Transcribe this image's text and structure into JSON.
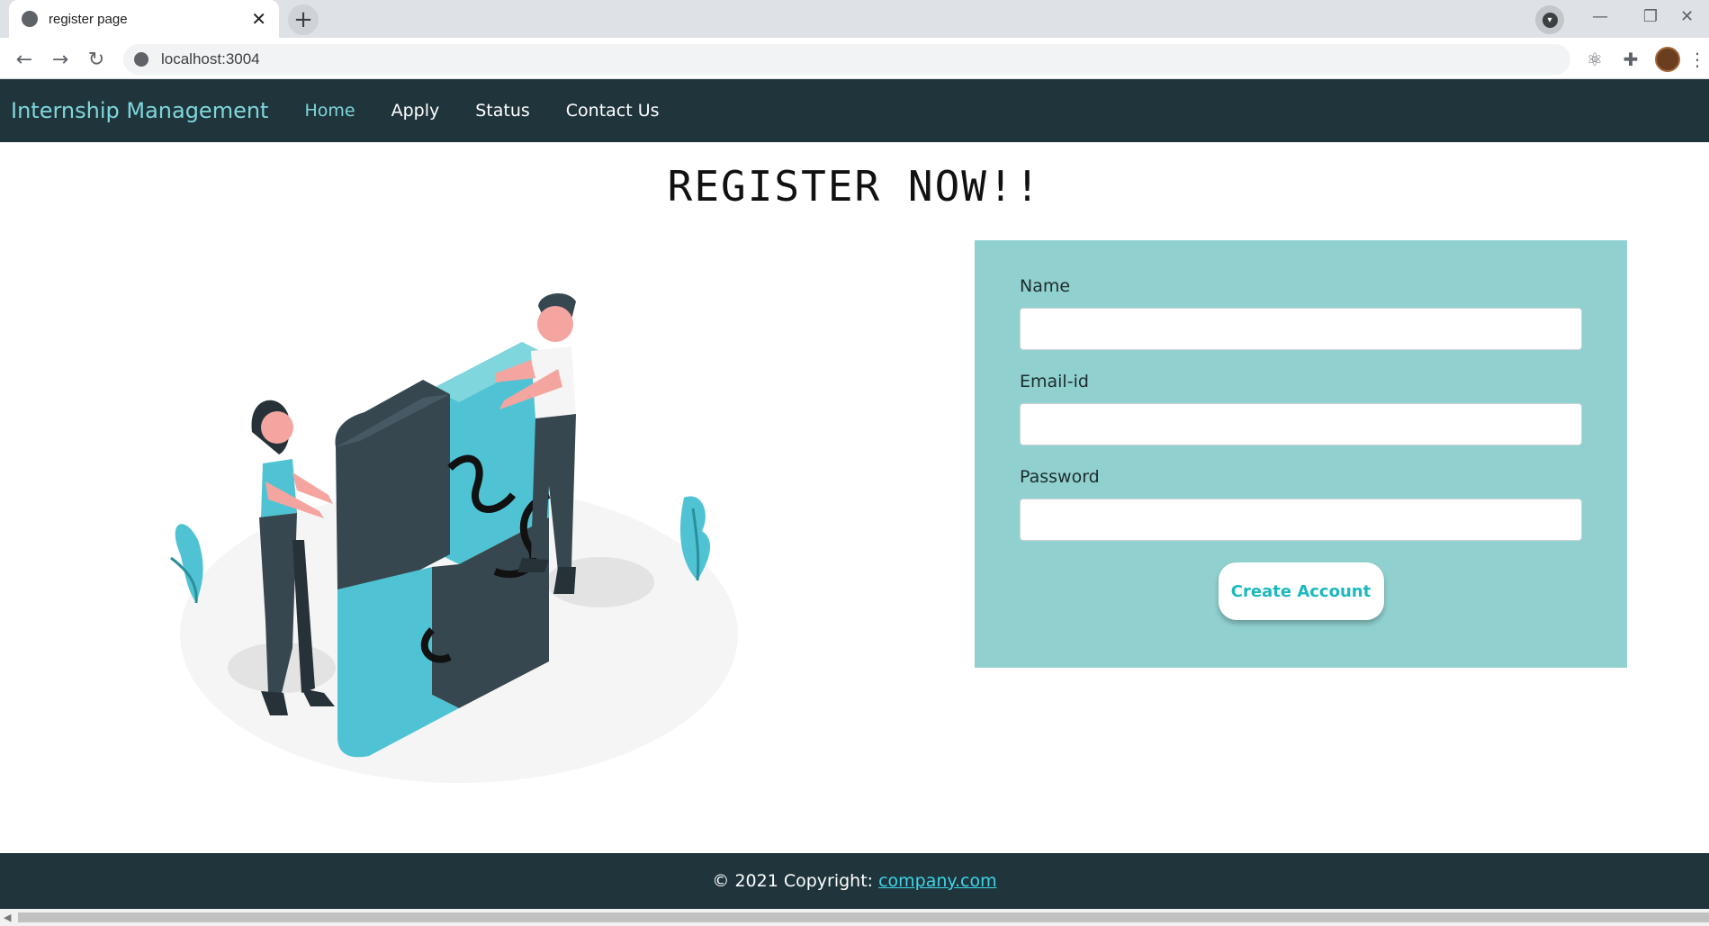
{
  "browser": {
    "tab_title": "register page",
    "tab_close": "✕",
    "new_tab": "+",
    "url": "localhost:3004"
  },
  "navbar": {
    "brand": "Internship Management",
    "links": [
      "Home",
      "Apply",
      "Status",
      "Contact Us"
    ],
    "active_link": "Home"
  },
  "main": {
    "heading": "REGISTER NOW!!"
  },
  "form": {
    "fields": [
      {
        "label": "Name",
        "value": ""
      },
      {
        "label": "Email-id",
        "value": ""
      },
      {
        "label": "Password",
        "value": ""
      }
    ],
    "submit_label": "Create Account"
  },
  "footer": {
    "copyright": "© 2021 Copyright:",
    "link": "company.com"
  },
  "colors": {
    "navbar_bg": "#1f353b",
    "brand": "#7fd6dc",
    "form_bg": "#90d1d0",
    "button_text": "#1cb9bd",
    "footer_link": "#3fd4e6",
    "puzzle_teal": "#4fc3d4",
    "puzzle_dark": "#37474f"
  }
}
